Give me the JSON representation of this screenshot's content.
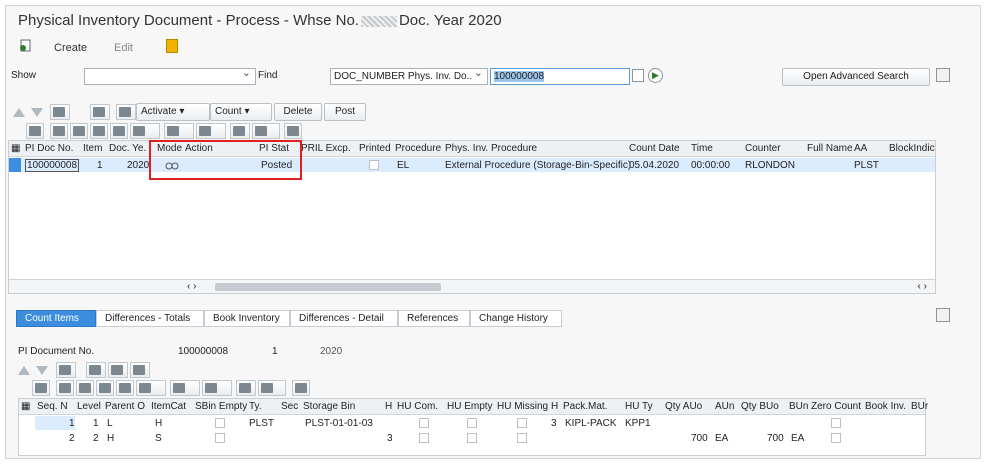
{
  "window": {
    "title_pre": "Physical Inventory Document - Process - Whse No.",
    "title_post": "Doc. Year 2020"
  },
  "toolbar": {
    "create": "Create",
    "edit": "Edit"
  },
  "search": {
    "show_label": "Show",
    "find_label": "Find",
    "field": "DOC_NUMBER Phys. Inv. Do..",
    "value": "100000008",
    "adv_button": "Open Advanced Search"
  },
  "grid_toolbar": {
    "activate": "Activate",
    "count": "Count",
    "delete": "Delete",
    "post": "Post"
  },
  "top_table": {
    "columns": [
      "PI Doc No.",
      "Item",
      "Doc. Ye.",
      "Mode",
      "Action",
      "PI Stat",
      "PRIL Excp.",
      "Printed",
      "Procedure",
      "Phys. Inv. Procedure",
      "Count Date",
      "Time",
      "Counter",
      "Full Name",
      "AA",
      "BlockIndic"
    ],
    "row": {
      "doc": "100000008",
      "item": "1",
      "year": "2020",
      "mode": "👓",
      "status": "Posted",
      "procedure": "EL",
      "procedure_text": "External Procedure (Storage-Bin-Specific)",
      "count_date": "05.04.2020",
      "time": "00:00:00",
      "counter": "RLONDON",
      "aa": "PLST"
    }
  },
  "tabs": [
    "Count Items",
    "Differences - Totals",
    "Book Inventory",
    "Differences - Detail",
    "References",
    "Change History"
  ],
  "detail": {
    "label": "PI Document No.",
    "doc": "100000008",
    "item": "1",
    "year": "2020"
  },
  "bottom_table": {
    "columns": [
      "Seq. N",
      "Level",
      "Parent O",
      "ItemCat",
      "SBin Empty",
      "Ty.",
      "Sec",
      "Storage Bin",
      "H",
      "HU Com.",
      "HU Empty",
      "HU Missing",
      "H",
      "Pack.Mat.",
      "HU Ty",
      "Qty AUo",
      "AUn",
      "Qty BUo",
      "BUn",
      "Zero Count",
      "Book Inv.",
      "BUr"
    ],
    "rows": [
      {
        "seq": "1",
        "level": "1",
        "parent": "L",
        "itemcat": "H",
        "ty": "PLST",
        "bin": "PLST-01-01-03",
        "h2": "3",
        "pack": "KIPL-PACK",
        "huty": "KPP1",
        "qauo": "",
        "aun": "",
        "qbuo": "",
        "bun": ""
      },
      {
        "seq": "2",
        "level": "2",
        "parent": "H",
        "itemcat": "S",
        "ty": "",
        "bin": "",
        "h1": "3",
        "pack": "",
        "huty": "",
        "qauo": "700",
        "aun": "EA",
        "qbuo": "700",
        "bun": "EA"
      }
    ]
  },
  "colors": {
    "accent": "#3c8dde",
    "highlight": "#e02020",
    "selected_row": "#dcecff"
  }
}
